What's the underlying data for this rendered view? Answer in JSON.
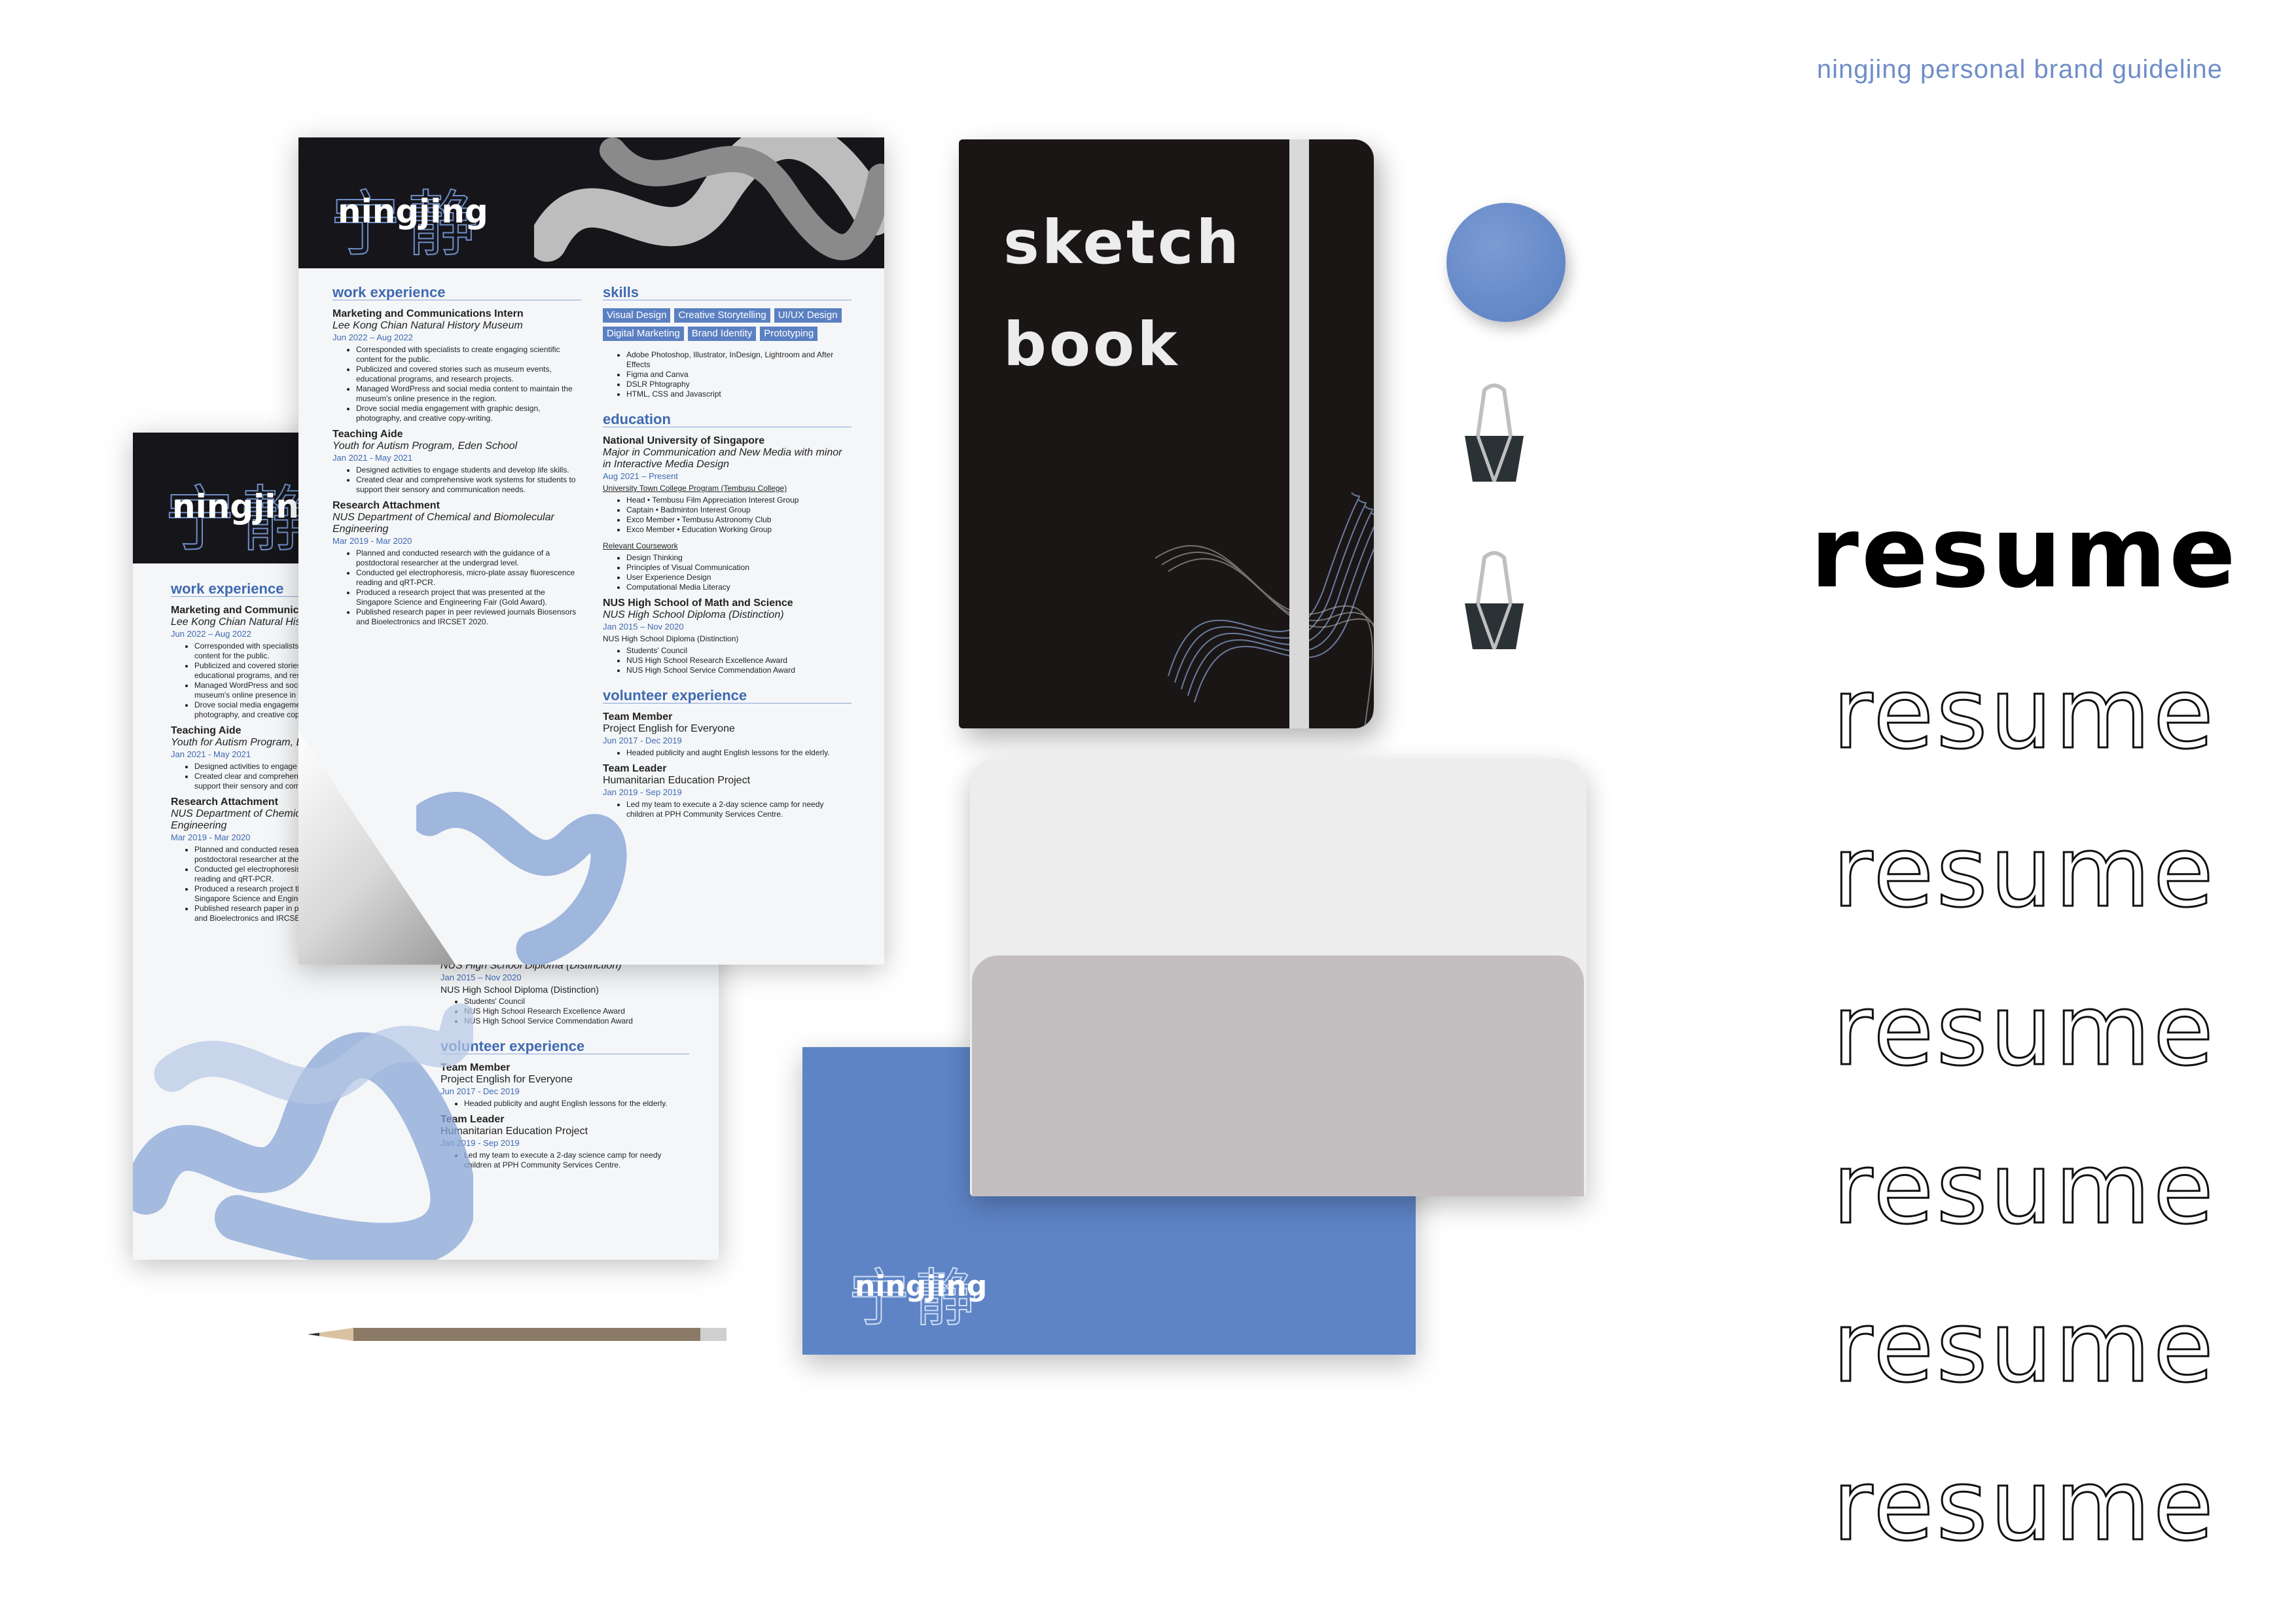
{
  "header": {
    "text": "ningjing personal brand guideline"
  },
  "colors": {
    "accent": "#5e84c6",
    "dark": "#1b1616",
    "light": "#f4f6f8"
  },
  "logo": {
    "cn": "宁静",
    "en": "ningjing"
  },
  "resume": {
    "work_heading": "work experience",
    "jobs": [
      {
        "title": "Marketing and Communications Intern",
        "org": "Lee Kong Chian Natural History Museum",
        "date": "Jun 2022 – Aug 2022",
        "bullets": [
          "Corresponded with specialists to create engaging scientific content for the public.",
          "Publicized and covered stories such as museum events, educational programs, and research projects.",
          "Managed WordPress and social media content to maintain the museum's online presence in the region.",
          "Drove social media engagement with graphic design, photography, and creative copy-writing."
        ]
      },
      {
        "title": "Teaching Aide",
        "org": "Youth for Autism Program, Eden School",
        "date": "Jan 2021 - May 2021",
        "bullets": [
          "Designed activities to engage students and develop life skills.",
          "Created clear and comprehensive work systems for students to support their sensory and communication needs."
        ]
      },
      {
        "title": "Research Attachment",
        "org": "NUS Department of Chemical and Biomolecular Engineering",
        "date": "Mar 2019 - Mar 2020",
        "bullets": [
          "Planned and conducted research with the guidance of a postdoctoral researcher at the undergrad level.",
          "Conducted gel electrophoresis, micro-plate assay fluorescence reading and qRT-PCR.",
          "Produced a research project that was presented at the Singapore Science and Engineering Fair (Gold Award).",
          "Published research paper in peer reviewed journals Biosensors and Bioelectronics and IRCSET 2020."
        ]
      }
    ],
    "skills_heading": "skills",
    "skill_tags": [
      "Visual Design",
      "Creative Storytelling",
      "UI/UX Design",
      "Digital Marketing",
      "Brand Identity",
      "Prototyping"
    ],
    "skill_bullets": [
      "Adobe Photoshop, Illustrator, InDesign, Lightroom and After Effects",
      "Figma and Canva",
      "DSLR Phtography",
      "HTML, CSS and Javascript"
    ],
    "education_heading": "education",
    "education": [
      {
        "title": "National University of Singapore",
        "org": "Major in Communication and New Media with minor in Interactive Media Design",
        "date": "Aug 2021 – Present",
        "sub": "University Town College Program (Tembusu College)",
        "bullets": [
          "Head • Tembusu Film Appreciation Interest Group",
          "Captain • Badminton Interest Group",
          "Exco Member • Tembusu Astronomy Club",
          "Exco Member • Education Working Group"
        ],
        "sub2": "Relevant Coursework",
        "bullets2": [
          "Design Thinking",
          "Principles of Visual Communication",
          "User Experience Design",
          "Computational Media Literacy"
        ]
      },
      {
        "title": "NUS High School of Math and Science",
        "org": "NUS High School Diploma (Distinction)",
        "date": "Jan 2015 – Nov 2020",
        "sub": "NUS High School Diploma (Distinction)",
        "bullets": [
          "Students' Council",
          "NUS High School Research Excellence Award",
          "NUS High School Service Commendation Award"
        ]
      }
    ],
    "volunteer_heading": "volunteer experience",
    "volunteer": [
      {
        "title": "Team Member",
        "org": "Project English for Everyone",
        "date": "Jun 2017 - Dec 2019",
        "bullets": [
          "Headed publicity and aught English lessons for the elderly."
        ]
      },
      {
        "title": "Team Leader",
        "org": "Humanitarian Education Project",
        "date": "Jan 2019 - Sep 2019",
        "bullets": [
          "Led my team to execute a 2-day science camp for needy children at PPH Community Services Centre."
        ]
      }
    ]
  },
  "sketchbook": {
    "line1": "sketch",
    "line2": "book"
  },
  "words": [
    "resume",
    "resume",
    "resume",
    "resume",
    "resume",
    "resume",
    "resume"
  ]
}
